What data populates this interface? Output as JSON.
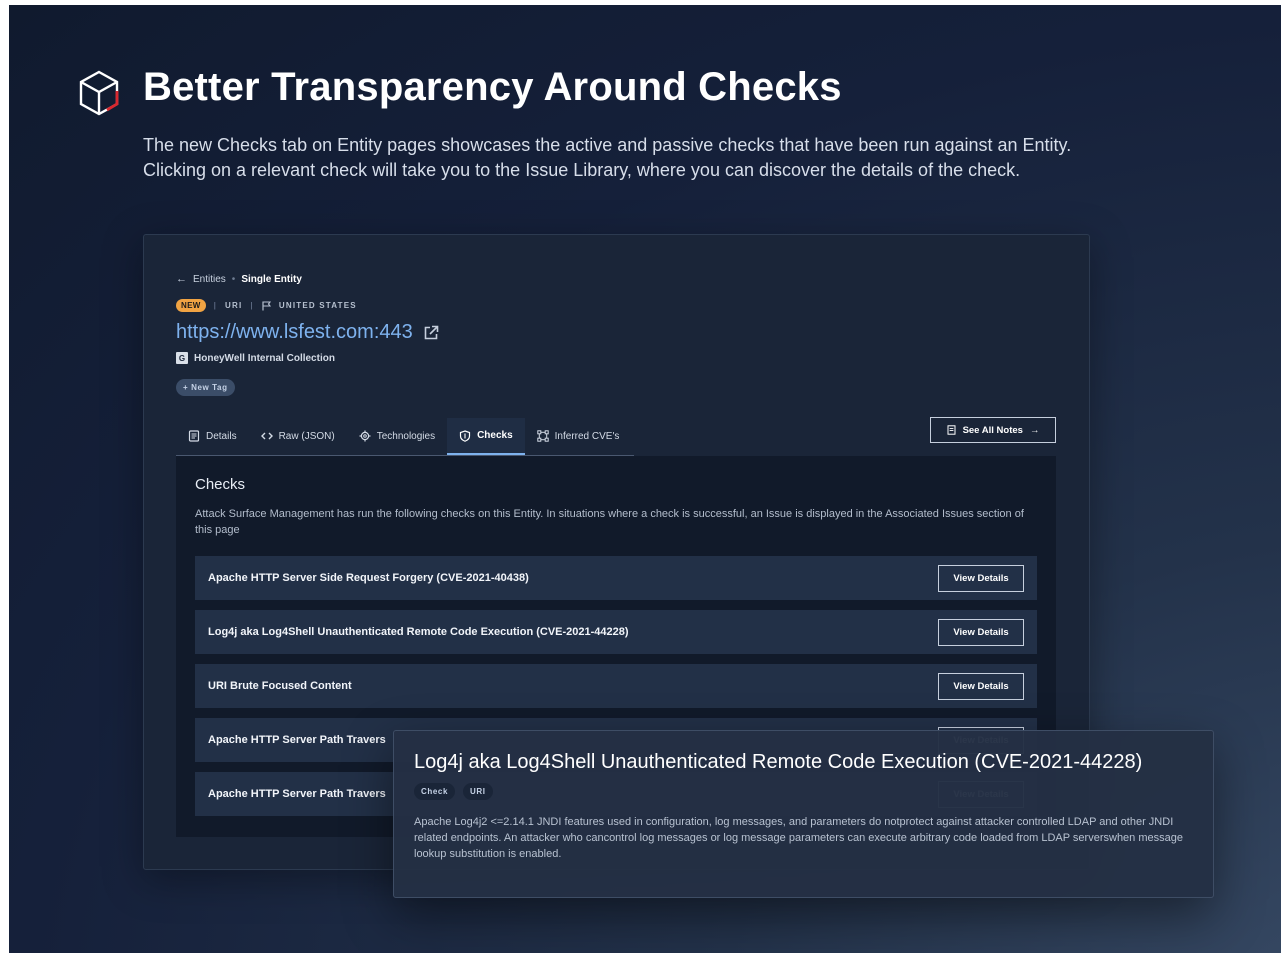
{
  "hero": {
    "title": "Better Transparency Around Checks",
    "description": "The new Checks tab on Entity pages showcases the active and passive checks that have been run against an Entity. Clicking on a relevant check will take you to the Issue Library, where you can discover the details of the check."
  },
  "breadcrumb": {
    "back_icon": "arrow-left-icon",
    "parent": "Entities",
    "current": "Single Entity"
  },
  "entity": {
    "badge": "NEW",
    "type": "URI",
    "country_icon": "flag-icon",
    "country": "UNITED STATES",
    "url": "https://www.lsfest.com:443",
    "collection_letter": "G",
    "collection": "HoneyWell Internal Collection",
    "new_tag": "+ New Tag"
  },
  "tabs": [
    {
      "label": "Details",
      "icon": "document-icon"
    },
    {
      "label": "Raw (JSON)",
      "icon": "code-icon"
    },
    {
      "label": "Technologies",
      "icon": "cog-icon"
    },
    {
      "label": "Checks",
      "icon": "shield-icon"
    },
    {
      "label": "Inferred CVE's",
      "icon": "network-icon"
    }
  ],
  "active_tab": "Checks",
  "see_all_notes": "See All Notes",
  "checks": {
    "title": "Checks",
    "description": "Attack Surface Management has run the following  checks on this Entity. In situations where a check is successful, an Issue is displayed in the Associated Issues section of this page",
    "view_details_label": "View Details",
    "items": [
      "Apache HTTP Server Side Request Forgery (CVE-2021-40438)",
      "Log4j aka Log4Shell Unauthenticated Remote Code Execution (CVE-2021-44228)",
      "URI Brute Focused Content",
      "Apache HTTP Server Path Travers",
      "Apache HTTP Server Path Travers"
    ]
  },
  "tooltip": {
    "title": "Log4j aka Log4Shell Unauthenticated Remote Code Execution (CVE-2021-44228)",
    "chips": [
      "Check",
      "URI"
    ],
    "description": "Apache Log4j2 <=2.14.1 JNDI features used in configuration, log messages, and parameters do notprotect against attacker controlled LDAP and other JNDI related endpoints. An attacker who cancontrol log messages or log message parameters can execute arbitrary code loaded from LDAP serverswhen message lookup substitution is enabled."
  },
  "colors": {
    "accent_blue": "#7eb2ee",
    "badge_orange": "#f0a343",
    "logo_red": "#d8282f"
  }
}
